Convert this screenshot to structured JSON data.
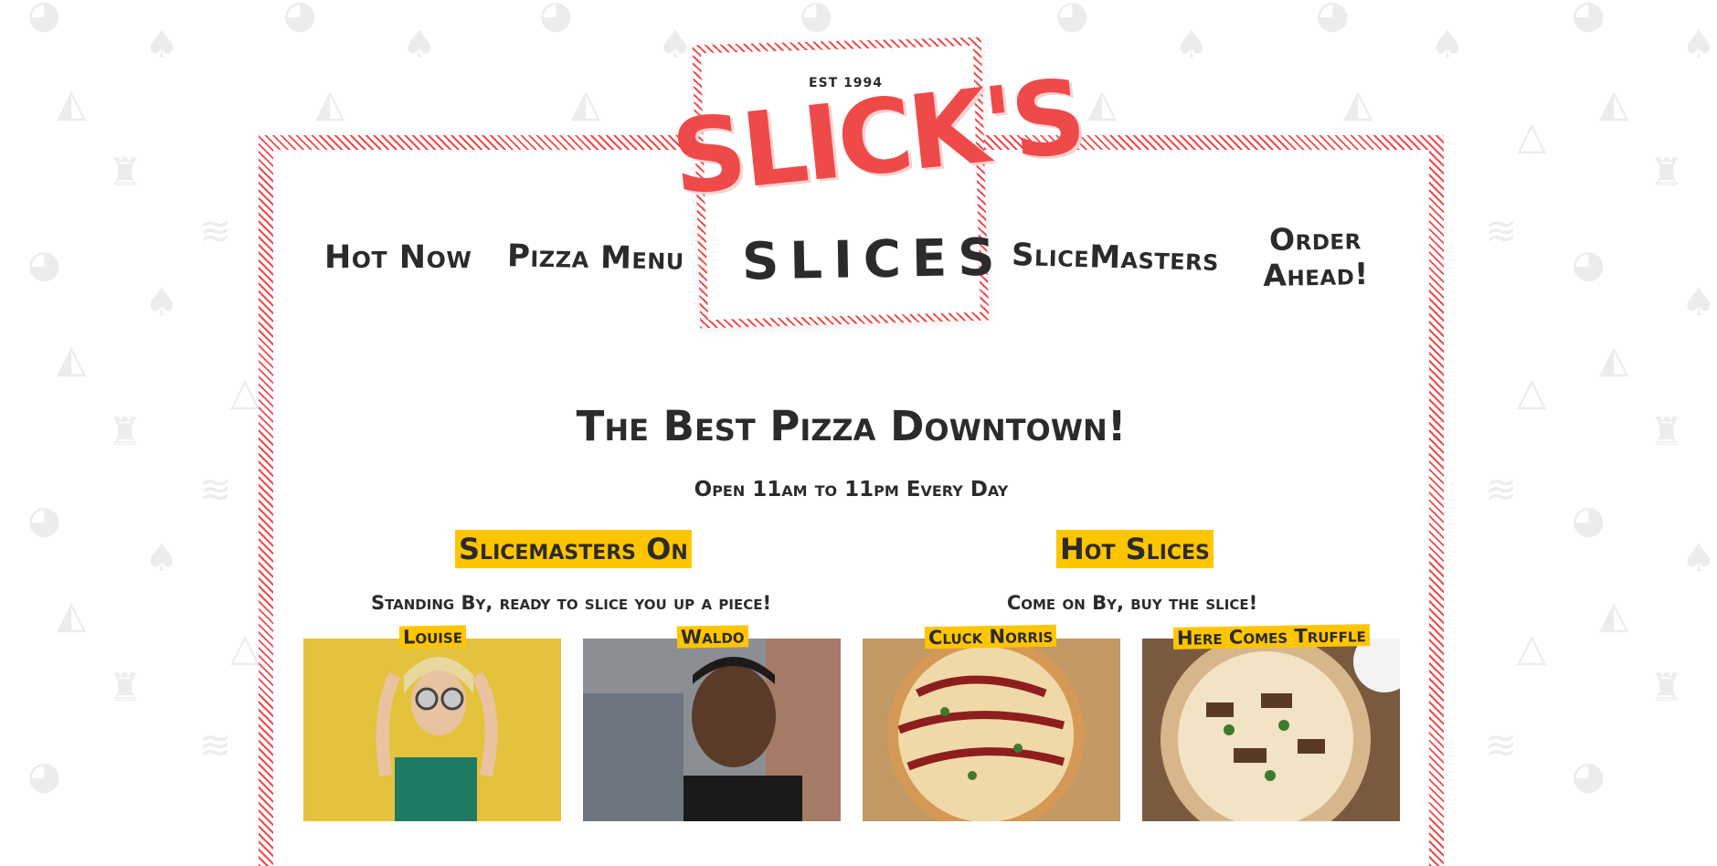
{
  "nav": {
    "hot_now": "Hot Now",
    "pizza_menu": "Pizza Menu",
    "slicemasters": "SliceMasters",
    "order_ahead_line1": "Order",
    "order_ahead_line2": "Ahead!"
  },
  "logo": {
    "est": "EST 1994",
    "brand": "SLICK'S",
    "sub": "SLICES"
  },
  "hero": {
    "headline": "The Best Pizza Downtown!",
    "hours": "Open 11am to 11pm Every Day"
  },
  "slicemasters": {
    "title": "Slicemasters On",
    "subtitle": "Standing By, ready to slice you up a piece!",
    "people": [
      {
        "name": "Louise"
      },
      {
        "name": "Waldo"
      }
    ]
  },
  "hot_slices": {
    "title": "Hot Slices",
    "subtitle": "Come on By, buy the slice!",
    "pizzas": [
      {
        "name": "Cluck Norris"
      },
      {
        "name": "Here Comes Truffle"
      }
    ]
  },
  "colors": {
    "brand_red": "#ef4a4a",
    "highlight_yellow": "#ffc600",
    "text_dark": "#2d2a2e"
  }
}
